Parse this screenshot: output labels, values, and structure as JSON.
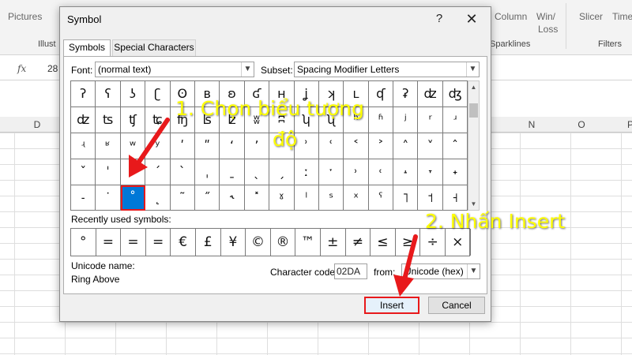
{
  "ribbon": {
    "left_items": [
      "Pictures"
    ],
    "left_group": "Illust",
    "right_items": [
      "Column",
      "Win/",
      "Loss",
      "Slicer",
      "Time"
    ],
    "sparklines_group": "Sparklines",
    "filters_group": "Filters"
  },
  "formula_bar": {
    "fx": "fx",
    "value": "28"
  },
  "columns": [
    "D",
    "N",
    "O",
    "P"
  ],
  "dialog": {
    "title": "Symbol",
    "help_icon": "question-icon",
    "close_icon": "close-icon",
    "tabs": [
      "Symbols",
      "Special Characters"
    ],
    "font_label": "Font:",
    "font_value": "(normal text)",
    "subset_label": "Subset:",
    "subset_value": "Spacing Modifier Letters",
    "symbols": [
      [
        "ʔ",
        "ʕ",
        "ʖ",
        "ʗ",
        "ʘ",
        "ʙ",
        "ʚ",
        "ʛ",
        "ʜ",
        "ʝ",
        "ʞ",
        "ʟ",
        "ʠ",
        "ʡ",
        "ʣ",
        "ʤ"
      ],
      [
        "ʣ",
        "ʦ",
        "ʧ",
        "ʨ",
        "ʩ",
        "ʪ",
        "ʫ",
        "ʬ",
        "ʭ",
        "ʮ",
        "ʯ",
        "ʰ",
        "ʱ",
        "ʲ",
        "ʳ",
        "ʴ"
      ],
      [
        "ʵ",
        "ʶ",
        "ʷ",
        "ʸ",
        "ʹ",
        "ʺ",
        "ʻ",
        "ʼ",
        "ʽ",
        "ʾ",
        "ʿ",
        "˂",
        "˃",
        "˄",
        "˅",
        "ˆ"
      ],
      [
        "ˇ",
        "ˈ",
        "ˉ",
        "ˊ",
        "ˋ",
        "ˌ",
        "ˍ",
        "ˎ",
        "ˏ",
        "ː",
        "ˑ",
        "˒",
        "˓",
        "˔",
        "˕",
        "˖"
      ],
      [
        "˗",
        "˙",
        "˚",
        "˛",
        "˜",
        "˝",
        "˞",
        "˟",
        "ˠ",
        "ˡ",
        "ˢ",
        "ˣ",
        "ˤ",
        "˥",
        "˦",
        "˧"
      ]
    ],
    "selected_symbol": "˚",
    "recent_label": "Recently used symbols:",
    "recent": [
      "°",
      "=",
      "=",
      "=",
      "€",
      "£",
      "¥",
      "©",
      "®",
      "™",
      "±",
      "≠",
      "≤",
      "≥",
      "÷",
      "×"
    ],
    "recent_tail": "∞",
    "unicode_name_label": "Unicode name:",
    "unicode_name": "Ring Above",
    "char_code_label": "Character code:",
    "char_code": "02DA",
    "from_label": "from:",
    "from_value": "Unicode (hex)",
    "insert_label": "Insert",
    "cancel_label": "Cancel"
  },
  "annotations": {
    "step1": "1. Chọn biểu tượng",
    "step1_line2": "độ",
    "step2": "2. Nhấn Insert",
    "color": "#ffff00",
    "arrow_color": "#e8191b"
  }
}
